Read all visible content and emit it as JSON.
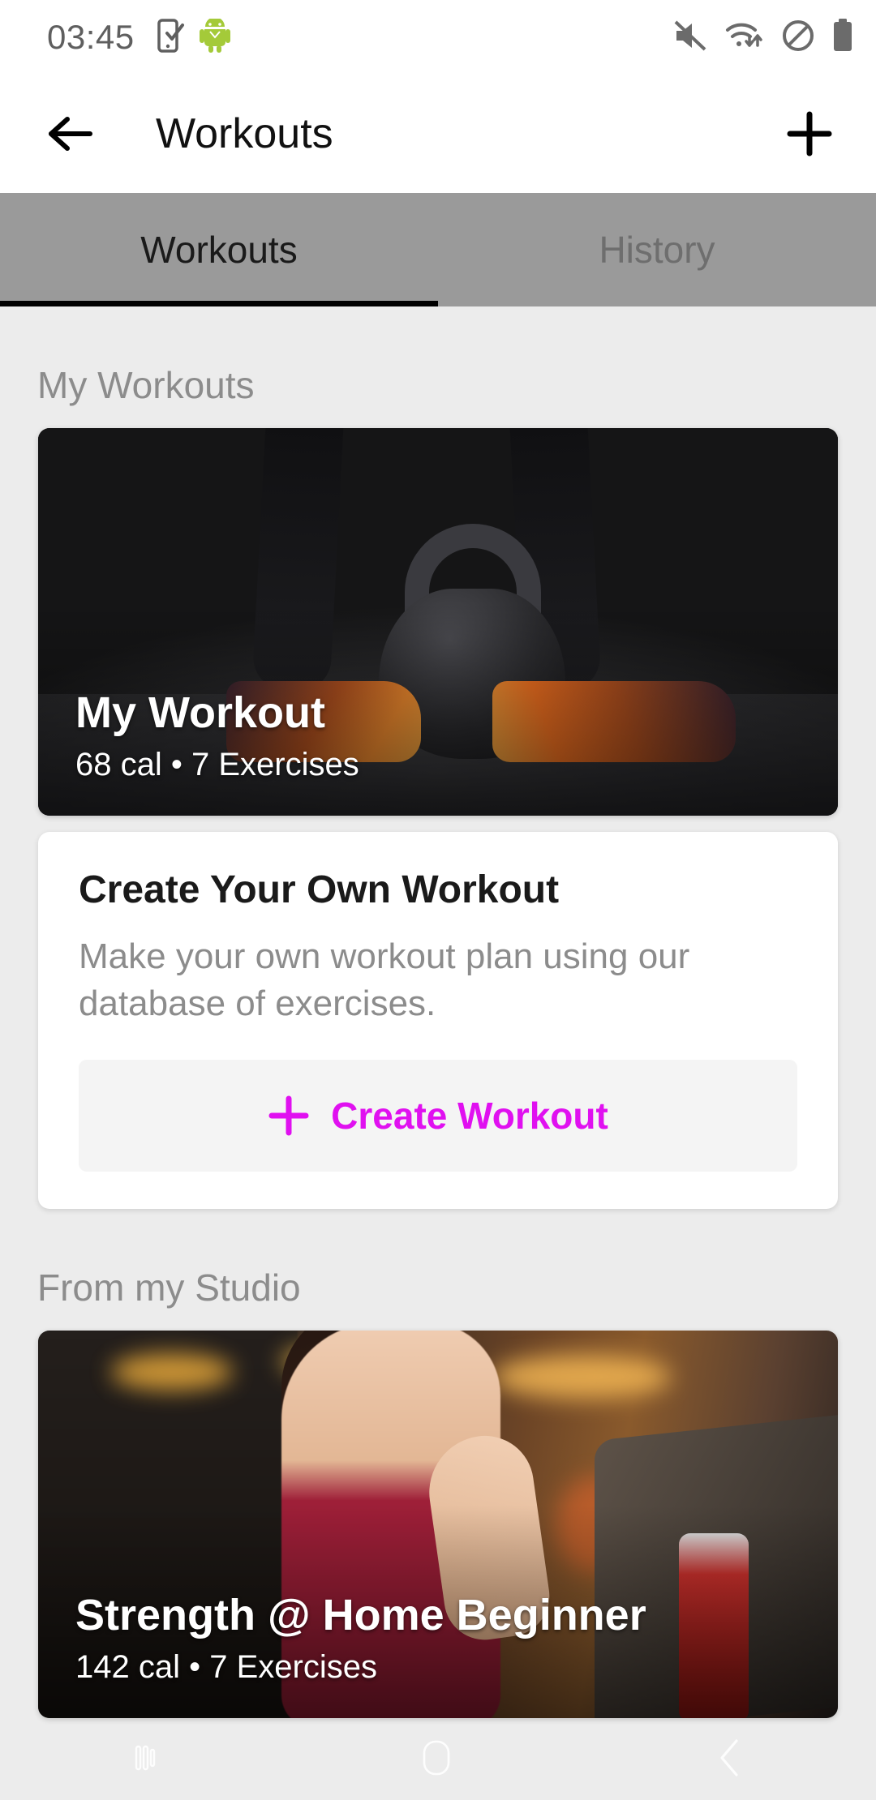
{
  "status_bar": {
    "time": "03:45",
    "left_icons": [
      "phone-check-icon",
      "android-mascot-icon"
    ],
    "right_icons": [
      "volume-muted-icon",
      "wifi-data-icon",
      "do-not-disturb-icon",
      "battery-full-icon"
    ]
  },
  "app_bar": {
    "back_icon": "back-arrow-icon",
    "title": "Workouts",
    "add_icon": "plus-icon"
  },
  "tabs": [
    {
      "label": "Workouts",
      "active": true
    },
    {
      "label": "History",
      "active": false
    }
  ],
  "sections": [
    {
      "title": "My Workouts",
      "workout_card": {
        "title": "My Workout",
        "subtitle": "68 cal • 7 Exercises",
        "calories": "68 cal",
        "exercises": "7 Exercises",
        "image": "kettlebell-gym-photo"
      },
      "create_card": {
        "title": "Create Your Own Workout",
        "description": "Make your own workout plan using our database of exercises.",
        "button_label": "Create Workout",
        "button_icon": "plus-icon"
      }
    },
    {
      "title": "From my Studio",
      "workout_card": {
        "title": "Strength @ Home Beginner",
        "subtitle": "142 cal • 7 Exercises",
        "calories": "142 cal",
        "exercises": "7 Exercises",
        "image": "treadmill-gym-photo"
      }
    }
  ],
  "nav_bar": {
    "recents_icon": "recents-icon",
    "home_icon": "home-icon",
    "back_icon": "back-chevron-icon"
  },
  "colors": {
    "accent": "#E010F0",
    "page_background": "#ECECEC",
    "tabbar_background": "#9A9A9A",
    "card_background": "#FFFFFF",
    "section_title": "#8C8C8C"
  }
}
